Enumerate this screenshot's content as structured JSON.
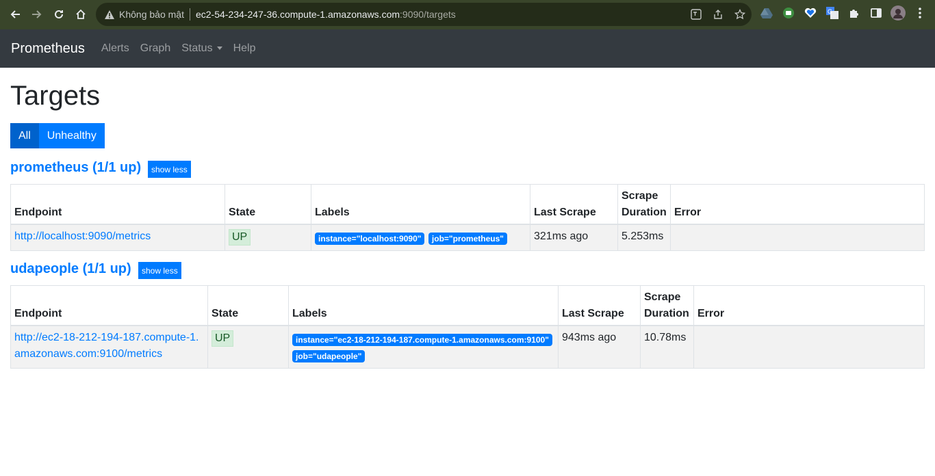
{
  "browser": {
    "insecure_label": "Không bảo mật",
    "url_host": "ec2-54-234-247-36.compute-1.amazonaws.com",
    "url_rest": ":9090/targets"
  },
  "navbar": {
    "brand": "Prometheus",
    "links": [
      "Alerts",
      "Graph",
      "Status",
      "Help"
    ]
  },
  "page": {
    "title": "Targets",
    "filter_all": "All",
    "filter_unhealthy": "Unhealthy"
  },
  "columns": {
    "endpoint": "Endpoint",
    "state": "State",
    "labels": "Labels",
    "last_scrape": "Last Scrape",
    "scrape_duration_1": "Scrape",
    "scrape_duration_2": "Duration",
    "error": "Error"
  },
  "pools": [
    {
      "title": "prometheus (1/1 up)",
      "toggle": "show less",
      "endpoint": "http://localhost:9090/metrics",
      "state": "UP",
      "labels": [
        "instance=\"localhost:9090\"",
        "job=\"prometheus\""
      ],
      "last_scrape": "321ms ago",
      "duration": "5.253ms",
      "error": ""
    },
    {
      "title": "udapeople (1/1 up)",
      "toggle": "show less",
      "endpoint_line1": "http://ec2-18-212-194-187.compute-1.",
      "endpoint_line2": "amazonaws.com:9100/metrics",
      "state": "UP",
      "labels": [
        "instance=\"ec2-18-212-194-187.compute-1.amazonaws.com:9100\"",
        "job=\"udapeople\""
      ],
      "last_scrape": "943ms ago",
      "duration": "10.78ms",
      "error": ""
    }
  ]
}
